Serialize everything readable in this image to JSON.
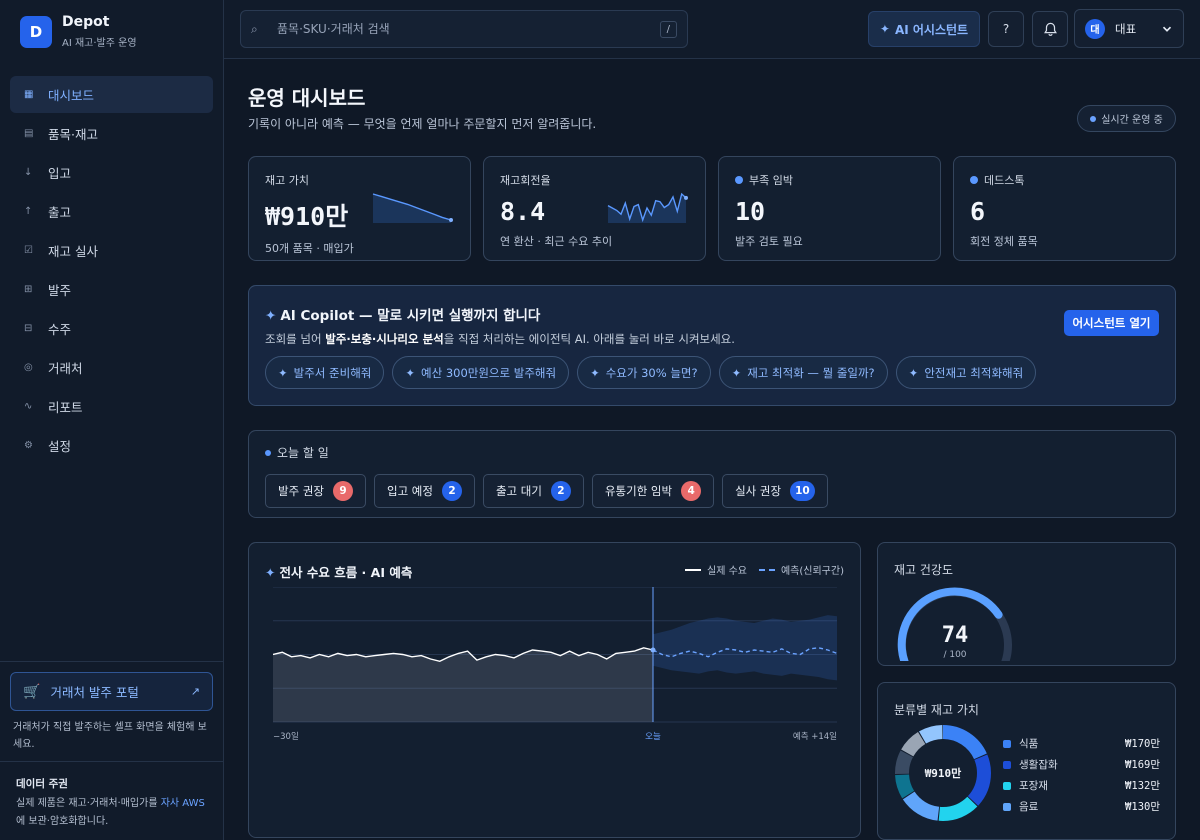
{
  "brand": {
    "logo_letter": "D",
    "name": "Depot",
    "subtitle": "AI 재고·발주 운영"
  },
  "nav": [
    {
      "label": "대시보드",
      "icon": "grid-icon",
      "active": true
    },
    {
      "label": "품목·재고",
      "icon": "list-icon"
    },
    {
      "label": "입고",
      "icon": "arrow-down-icon"
    },
    {
      "label": "출고",
      "icon": "arrow-up-icon"
    },
    {
      "label": "재고 실사",
      "icon": "checkbox-icon"
    },
    {
      "label": "발주",
      "icon": "plus-box-icon"
    },
    {
      "label": "수주",
      "icon": "minus-box-icon"
    },
    {
      "label": "거래처",
      "icon": "partner-icon"
    },
    {
      "label": "리포트",
      "icon": "trend-icon"
    },
    {
      "label": "설정",
      "icon": "gear-icon"
    }
  ],
  "portal": {
    "label": "거래처 발주 포털",
    "desc": "거래처가 직접 발주하는 셀프 화면을 체험해 보세요."
  },
  "governance": {
    "title": "데이터 주권",
    "desc_before": "실제 제품은 재고·거래처·매입가를 ",
    "desc_link": "자사 AWS",
    "desc_after": "에 보관·암호화합니다."
  },
  "topbar": {
    "search_placeholder": "품목·SKU·거래처 검색",
    "search_shortcut": "/",
    "ai_button": "AI 어시스턴트",
    "help_label": "?",
    "user_initial": "대",
    "user_name": "대표"
  },
  "page": {
    "title": "운영 대시보드",
    "subtitle": "기록이 아니라 예측 — 무엇을 언제 얼마나 주문할지 먼저 알려줍니다.",
    "live_badge": "실시간 운영 중"
  },
  "kpis": [
    {
      "label": "재고 가치",
      "value": "₩910만",
      "note": "50개 품목 · 매입가",
      "spark": [
        10,
        9.6,
        9.2,
        8.8,
        8.4,
        7.9,
        7.4,
        6.9,
        6.4,
        6.0
      ]
    },
    {
      "label": "재고회전율",
      "value": "8.4",
      "note": "연 환산 · 최근 수요 추이",
      "spark": [
        6,
        5.5,
        5,
        4.2,
        6.5,
        3.2,
        5.8,
        6.2,
        3,
        5.5,
        4,
        7,
        6.8,
        5.6,
        6.2,
        7.8,
        4.8,
        8.4,
        7.6
      ]
    },
    {
      "label": "부족 임박",
      "value": "10",
      "note": "발주 검토 필요",
      "dot": true
    },
    {
      "label": "데드스톡",
      "value": "6",
      "note": "회전 정체 품목",
      "dot": true
    }
  ],
  "copilot": {
    "title": "AI Copilot — 말로 시키면 실행까지 합니다",
    "desc_before": "조회를 넘어 ",
    "desc_bold": "발주·보충·시나리오 분석",
    "desc_after": "을 직접 처리하는 에이전틱 AI. 아래를 눌러 바로 시켜보세요.",
    "open_button": "어시스턴트 열기",
    "chips": [
      "발주서 준비해줘",
      "예산 300만원으로 발주해줘",
      "수요가 30% 늘면?",
      "재고 최적화 — 뭘 줄일까?",
      "안전재고 최적화해줘"
    ]
  },
  "todo": {
    "title": "오늘 할 일",
    "items": [
      {
        "label": "발주 권장",
        "count": "9",
        "tone": "red"
      },
      {
        "label": "입고 예정",
        "count": "2",
        "tone": "blue"
      },
      {
        "label": "출고 대기",
        "count": "2",
        "tone": "blue"
      },
      {
        "label": "유통기한 임박",
        "count": "4",
        "tone": "red"
      },
      {
        "label": "실사 권장",
        "count": "10",
        "tone": "blue"
      }
    ]
  },
  "chart_data": [
    {
      "type": "line",
      "title": "전사 수요 흐름 · AI 예측",
      "x_labels": [
        "−30일",
        "오늘",
        "예측 +14일"
      ],
      "series": [
        {
          "name": "실제 수요",
          "values": [
            60,
            62,
            58,
            59,
            57,
            60,
            58,
            61,
            59,
            60,
            58,
            59,
            60,
            61,
            60,
            58,
            59,
            56,
            54,
            58,
            61,
            63,
            55,
            58,
            60,
            59,
            57,
            61,
            64,
            63,
            62,
            59,
            63,
            59,
            62,
            60,
            56,
            61,
            62,
            63,
            66,
            64
          ]
        },
        {
          "name": "예측(신뢰구간)",
          "values": [
            64,
            60,
            58,
            61,
            63,
            61,
            58,
            62,
            65,
            64,
            62,
            64,
            63,
            62,
            65,
            61,
            60,
            65,
            66,
            64,
            61
          ],
          "lower": [
            50,
            48,
            46,
            45,
            44,
            43,
            45,
            46,
            44,
            43,
            44,
            45,
            43,
            42,
            41,
            43,
            42,
            41,
            40,
            38,
            37
          ],
          "upper": [
            78,
            80,
            82,
            85,
            88,
            90,
            92,
            93,
            92,
            90,
            89,
            88,
            90,
            92,
            91,
            89,
            90,
            91,
            93,
            95,
            94
          ]
        }
      ],
      "ylim": [
        0,
        120
      ],
      "grid": true,
      "legend": "top-right"
    },
    {
      "type": "pie",
      "title": "분류별 재고 가치",
      "center_label": "₩910만",
      "categories": [
        "식품",
        "생활잡화",
        "포장재",
        "음료"
      ],
      "values": [
        170,
        169,
        132,
        130
      ],
      "display_values": [
        "₩170만",
        "₩169만",
        "₩132만",
        "₩130만"
      ],
      "colors": [
        "#3b82f6",
        "#1d4ed8",
        "#22d3ee",
        "#60a5fa"
      ],
      "other_value": 309,
      "other_colors": [
        "#0e7490",
        "#3a4b63",
        "#9aa5b4",
        "#93c5fd"
      ]
    }
  ],
  "health": {
    "title": "재고 건강도",
    "score": "74",
    "max": "/ 100",
    "value": 74
  }
}
